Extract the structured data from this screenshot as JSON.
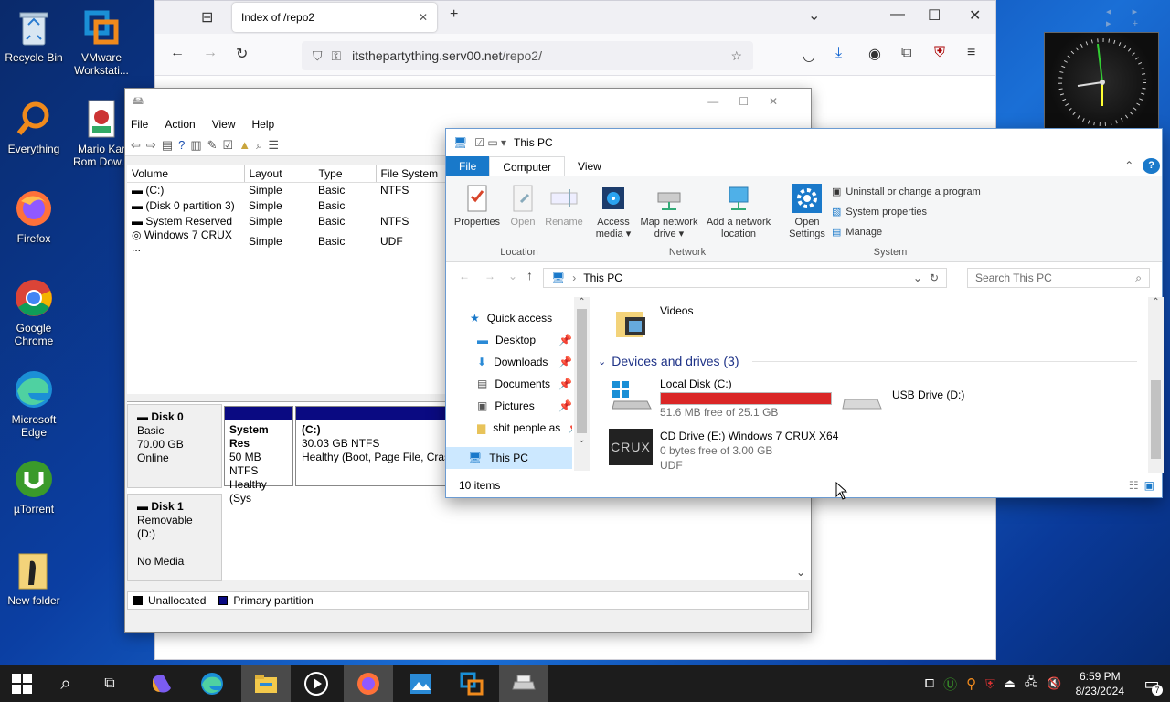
{
  "desktop": {
    "icons": [
      {
        "label": "Recycle Bin",
        "icon": "recycle-bin-icon"
      },
      {
        "label": "VMware Workstati...",
        "icon": "vmware-icon"
      },
      {
        "label": "Everything",
        "icon": "everything-search-icon"
      },
      {
        "label": "Mario Kar Rom Dow...",
        "icon": "document-icon"
      },
      {
        "label": "Firefox",
        "icon": "firefox-icon"
      },
      {
        "label": "Google Chrome",
        "icon": "chrome-icon"
      },
      {
        "label": "Microsoft Edge",
        "icon": "edge-icon"
      },
      {
        "label": "µTorrent",
        "icon": "utorrent-icon"
      },
      {
        "label": "New folder",
        "icon": "folder-icon"
      }
    ]
  },
  "firefox": {
    "tab_title": "Index of /repo2",
    "url_host": "itsthepartything.serv00.net",
    "url_path": "/repo2/"
  },
  "disk_management": {
    "menu": [
      "File",
      "Action",
      "View",
      "Help"
    ],
    "columns": [
      "Volume",
      "Layout",
      "Type",
      "File System"
    ],
    "rows": [
      {
        "volume": "(C:)",
        "layout": "Simple",
        "type": "Basic",
        "fs": "NTFS"
      },
      {
        "volume": "(Disk 0 partition 3)",
        "layout": "Simple",
        "type": "Basic",
        "fs": ""
      },
      {
        "volume": "System Reserved",
        "layout": "Simple",
        "type": "Basic",
        "fs": "NTFS"
      },
      {
        "volume": "Windows 7 CRUX ...",
        "layout": "Simple",
        "type": "Basic",
        "fs": "UDF"
      }
    ],
    "disk0": {
      "name": "Disk 0",
      "kind": "Basic",
      "size": "70.00 GB",
      "status": "Online",
      "part1_name": "System Res",
      "part1_size": "50 MB NTFS",
      "part1_status": "Healthy (Sys",
      "part2_name": "(C:)",
      "part2_size": "30.03 GB NTFS",
      "part2_status": "Healthy (Boot, Page File, Crash"
    },
    "disk1": {
      "name": "Disk 1",
      "kind": "Removable (D:)",
      "status": "No Media"
    },
    "legend": {
      "unallocated": "Unallocated",
      "primary": "Primary partition"
    }
  },
  "explorer": {
    "title": "This PC",
    "tabs": [
      "File",
      "Computer",
      "View"
    ],
    "ribbon": {
      "properties": "Properties",
      "open": "Open",
      "rename": "Rename",
      "access_media": "Access media ▾",
      "map_network": "Map network drive ▾",
      "add_network": "Add a network location",
      "open_settings": "Open Settings",
      "uninstall": "Uninstall or change a program",
      "system_properties": "System properties",
      "manage": "Manage",
      "group_location": "Location",
      "group_network": "Network",
      "group_system": "System"
    },
    "address": "This PC",
    "search_placeholder": "Search This PC",
    "nav": {
      "quick_access": "Quick access",
      "items": [
        "Desktop",
        "Downloads",
        "Documents",
        "Pictures",
        "shit people as"
      ],
      "this_pc": "This PC"
    },
    "content": {
      "videos": "Videos",
      "devices_header": "Devices and drives (3)",
      "local_disk": {
        "name": "Local Disk (C:)",
        "free": "51.6 MB free of 25.1 GB",
        "used_fraction": 0.998
      },
      "usb": {
        "name": "USB Drive (D:)"
      },
      "cd": {
        "name": "CD Drive (E:) Windows 7 CRUX X64",
        "free": "0 bytes free of 3.00 GB",
        "fs": "UDF",
        "logo": "CRUX"
      }
    },
    "status": "10 items"
  },
  "taskbar": {
    "time": "6:59 PM",
    "date": "8/23/2024",
    "notification_count": "7"
  }
}
